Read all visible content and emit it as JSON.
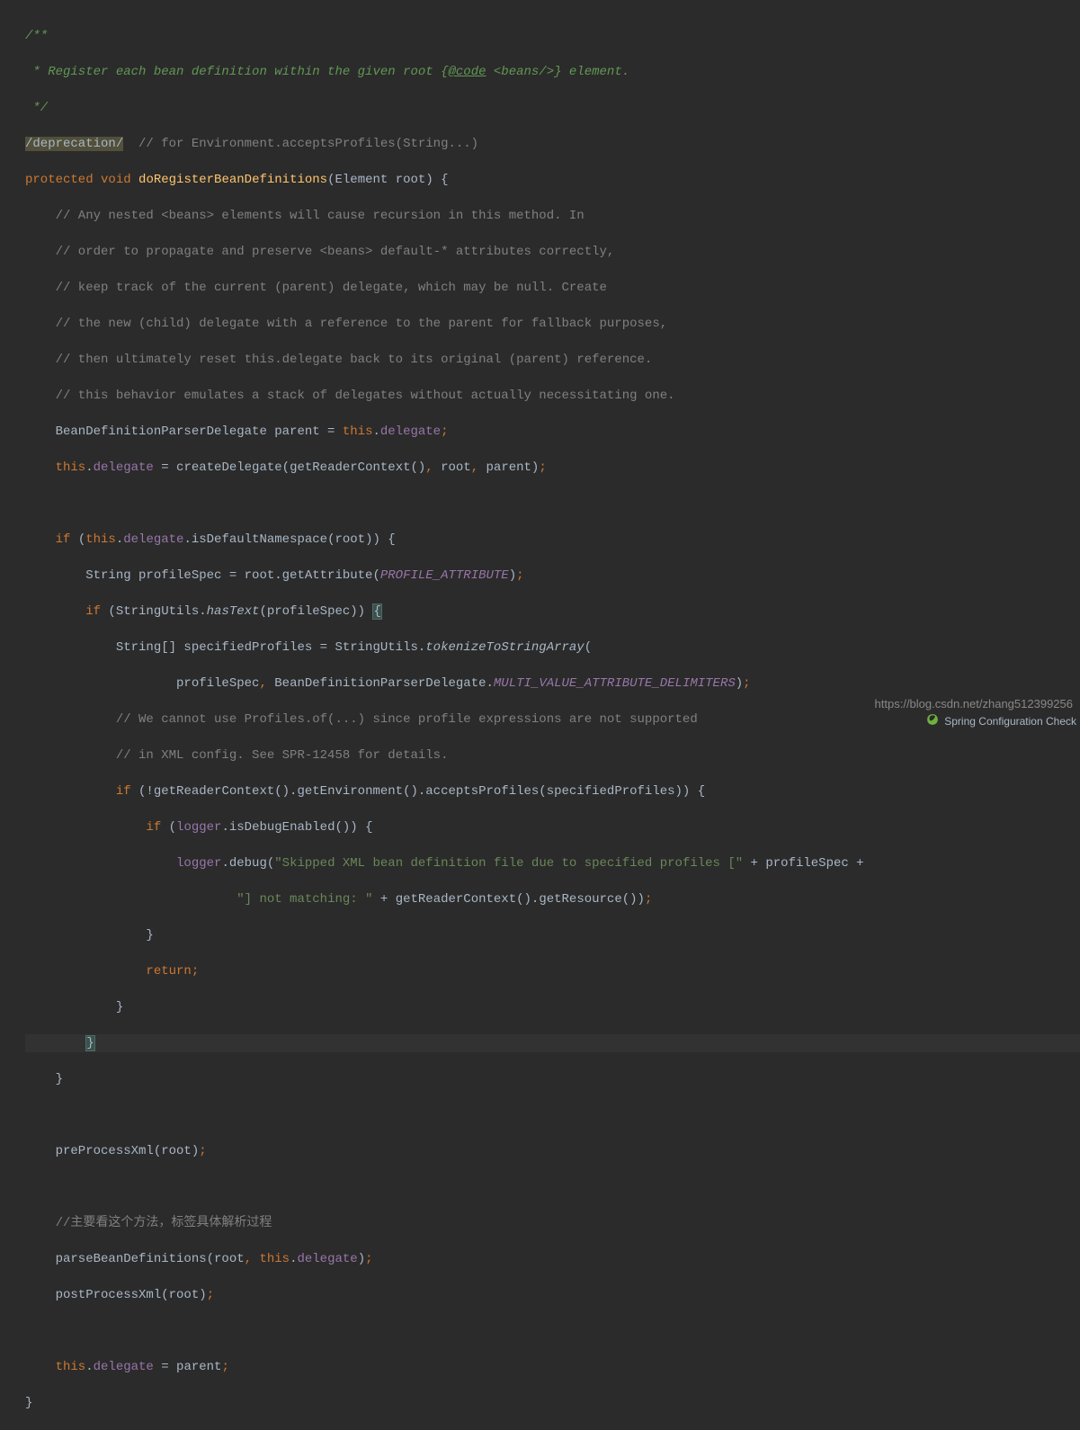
{
  "watermark": "https://blog.csdn.net/zhang512399256",
  "status": {
    "text": "Spring Configuration Check"
  },
  "code": {
    "doc1": "/**",
    "doc2_a": " * Register each bean definition within the given root {",
    "doc2_tag": "@code",
    "doc2_b": " <beans/>",
    "doc2_c": "} element.",
    "doc3": " */",
    "annot": "/deprecation/",
    "annotComment": "  // for Environment.acceptsProfiles(String...)",
    "kw_protected": "protected",
    "kw_void": " void ",
    "methodName": "doRegisterBeanDefinitions",
    "param_open": "(",
    "param_type": "Element ",
    "param_name": "root",
    "param_close": ") {",
    "c1": "    // Any nested <beans> elements will cause recursion in this method. In",
    "c2": "    // order to propagate and preserve <beans> default-* attributes correctly,",
    "c3": "    // keep track of the current (parent) delegate, which may be null. Create",
    "c4": "    // the new (child) delegate with a reference to the parent for fallback purposes,",
    "c5": "    // then ultimately reset this.delegate back to its original (parent) reference.",
    "c6": "    // this behavior emulates a stack of delegates without actually necessitating one.",
    "l7a": "    BeanDefinitionParserDelegate parent = ",
    "l7_this": "this",
    "l7_dot": ".",
    "l7_field": "delegate",
    "l7_semi": ";",
    "l8_this": "    this",
    "l8_dot": ".",
    "l8_field": "delegate",
    "l8_b": " = createDelegate(getReaderContext()",
    "l8_c1": ",",
    "l8_c2": " root",
    "l8_c3": ",",
    "l8_c4": " parent)",
    "l8_semi": ";",
    "l10_if": "    if ",
    "l10_o": "(",
    "l10_this": "this",
    "l10_dot": ".",
    "l10_field": "delegate",
    "l10_b": ".isDefaultNamespace(root)) {",
    "l11a": "        String profileSpec = root.getAttribute(",
    "l11_const": "PROFILE_ATTRIBUTE",
    "l11b": ")",
    "l11_semi": ";",
    "l12_if": "        if ",
    "l12a": "(StringUtils.",
    "l12_m": "hasText",
    "l12b": "(profileSpec)) ",
    "l12_brace": "{",
    "l13a": "            String[] specifiedProfiles = StringUtils.",
    "l13_m": "tokenizeToStringArray",
    "l13b": "(",
    "l14a": "                    profileSpec",
    "l14_c1": ",",
    "l14b": " BeanDefinitionParserDelegate.",
    "l14_const": "MULTI_VALUE_ATTRIBUTE_DELIMITERS",
    "l14c": ")",
    "l14_semi": ";",
    "l15": "            // We cannot use Profiles.of(...) since profile expressions are not supported",
    "l16": "            // in XML config. See SPR-12458 for details.",
    "l17_if": "            if ",
    "l17a": "(!getReaderContext().getEnvironment().acceptsProfiles(specifiedProfiles)) {",
    "l18_if": "                if ",
    "l18_o": "(",
    "l18_logger": "logger",
    "l18a": ".isDebugEnabled()) {",
    "l19a": "                    ",
    "l19_logger": "logger",
    "l19b": ".debug(",
    "l19_s1": "\"Skipped XML bean definition file due to specified profiles [\"",
    "l19c": " + profileSpec +",
    "l20a": "                            ",
    "l20_s2": "\"] not matching: \"",
    "l20b": " + getReaderContext().getResource())",
    "l20_semi": ";",
    "l21": "                }",
    "l22_ret": "                return",
    "l22_semi": ";",
    "l23": "            }",
    "l24": "        ",
    "l24_brace": "}",
    "l25": "    }",
    "l27a": "    preProcessXml(root)",
    "l27_semi": ";",
    "l29": "    //主要看这个方法，标签具体解析过程",
    "l30a": "    parseBeanDefinitions(root",
    "l30_c1": ",",
    "l30b": " ",
    "l30_this": "this",
    "l30_dot": ".",
    "l30_field": "delegate",
    "l30c": ")",
    "l30_semi": ";",
    "l31a": "    postProcessXml(root)",
    "l31_semi": ";",
    "l33_this": "    this",
    "l33_dot": ".",
    "l33_field": "delegate",
    "l33b": " = parent",
    "l33_semi": ";",
    "l34": "}"
  }
}
